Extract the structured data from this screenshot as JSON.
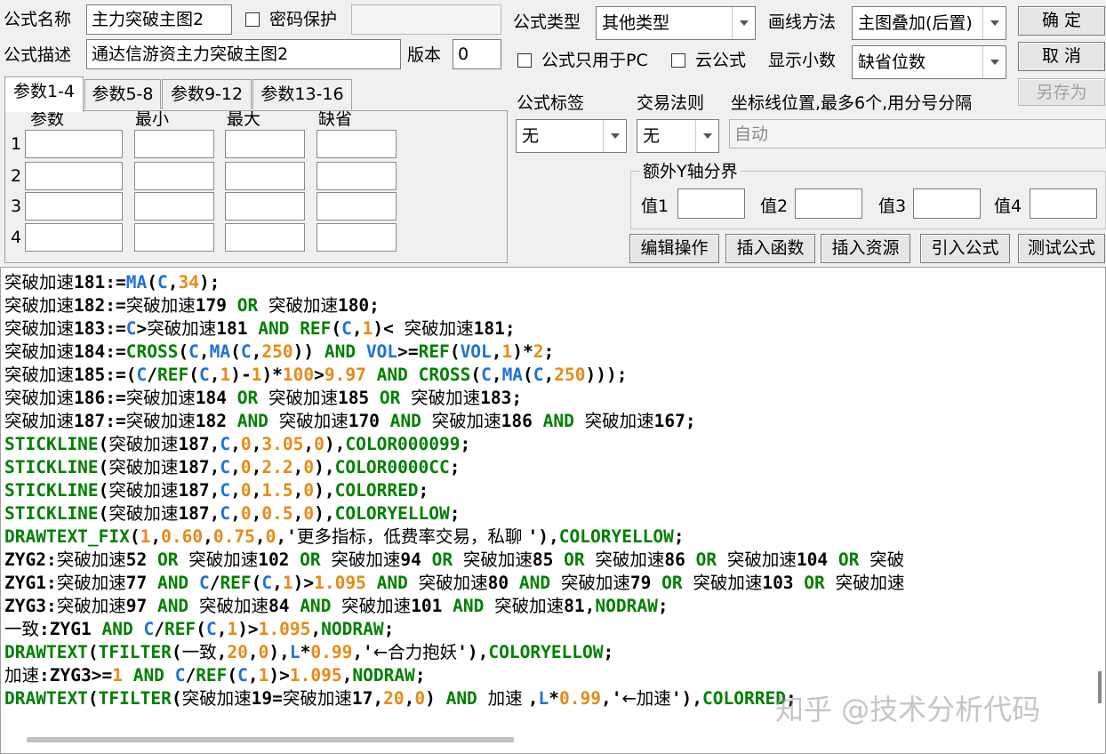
{
  "form": {
    "name_label": "公式名称",
    "name_value": "主力突破主图2",
    "password_label": "密码保护",
    "desc_label": "公式描述",
    "desc_value": "通达信游资主力突破主图2",
    "version_label": "版本",
    "version_value": "0",
    "type_label": "公式类型",
    "type_value": "其他类型",
    "draw_label": "画线方法",
    "draw_value": "主图叠加(后置)",
    "pc_only_label": "公式只用于PC",
    "cloud_label": "云公式",
    "decimals_label": "显示小数",
    "decimals_value": "缺省位数",
    "tag_label": "公式标签",
    "tag_value": "无",
    "rule_label": "交易法则",
    "rule_value": "无",
    "coord_label": "坐标线位置,最多6个,用分号分隔",
    "coord_value": "自动",
    "yaxis_label": "额外Y轴分界",
    "yaxis_values": [
      "值1",
      "值2",
      "值3",
      "值4"
    ]
  },
  "buttons": {
    "ok": "确 定",
    "cancel": "取 消",
    "save_as": "另存为",
    "edit": "编辑操作",
    "insert_func": "插入函数",
    "insert_res": "插入资源",
    "import": "引入公式",
    "test": "测试公式"
  },
  "params": {
    "tabs": [
      "参数1-4",
      "参数5-8",
      "参数9-12",
      "参数13-16"
    ],
    "headers": [
      "参数",
      "最小",
      "最大",
      "缺省"
    ],
    "rows": [
      "1",
      "2",
      "3",
      "4"
    ]
  },
  "code_lines": [
    [
      [
        "cn",
        "突破加速"
      ],
      [
        "k",
        "181:="
      ],
      [
        "b",
        "MA"
      ],
      [
        "k",
        "("
      ],
      [
        "b",
        "C"
      ],
      [
        "k",
        ","
      ],
      [
        "o",
        "34"
      ],
      [
        "k",
        ");"
      ]
    ],
    [
      [
        "cn",
        "突破加速"
      ],
      [
        "k",
        "182:="
      ],
      [
        "cn",
        "突破加速"
      ],
      [
        "k",
        "179 "
      ],
      [
        "g",
        "OR"
      ],
      [
        "k",
        " "
      ],
      [
        "cn",
        "突破加速"
      ],
      [
        "k",
        "180;"
      ]
    ],
    [
      [
        "cn",
        "突破加速"
      ],
      [
        "k",
        "183:="
      ],
      [
        "b",
        "C"
      ],
      [
        "k",
        ">"
      ],
      [
        "cn",
        "突破加速"
      ],
      [
        "k",
        "181 "
      ],
      [
        "g",
        "AND"
      ],
      [
        "k",
        " "
      ],
      [
        "g",
        "REF"
      ],
      [
        "k",
        "("
      ],
      [
        "b",
        "C"
      ],
      [
        "k",
        ","
      ],
      [
        "o",
        "1"
      ],
      [
        "k",
        ")< "
      ],
      [
        "cn",
        "突破加速"
      ],
      [
        "k",
        "181;"
      ]
    ],
    [
      [
        "cn",
        "突破加速"
      ],
      [
        "k",
        "184:="
      ],
      [
        "g",
        "CROSS"
      ],
      [
        "k",
        "("
      ],
      [
        "b",
        "C"
      ],
      [
        "k",
        ","
      ],
      [
        "b",
        "MA"
      ],
      [
        "k",
        "("
      ],
      [
        "b",
        "C"
      ],
      [
        "k",
        ","
      ],
      [
        "o",
        "250"
      ],
      [
        "k",
        ")) "
      ],
      [
        "g",
        "AND"
      ],
      [
        "k",
        " "
      ],
      [
        "b",
        "VOL"
      ],
      [
        "k",
        ">="
      ],
      [
        "g",
        "REF"
      ],
      [
        "k",
        "("
      ],
      [
        "b",
        "VOL"
      ],
      [
        "k",
        ","
      ],
      [
        "o",
        "1"
      ],
      [
        "k",
        ")*"
      ],
      [
        "o",
        "2"
      ],
      [
        "k",
        ";"
      ]
    ],
    [
      [
        "cn",
        "突破加速"
      ],
      [
        "k",
        "185:=("
      ],
      [
        "b",
        "C"
      ],
      [
        "k",
        "/"
      ],
      [
        "g",
        "REF"
      ],
      [
        "k",
        "("
      ],
      [
        "b",
        "C"
      ],
      [
        "k",
        ","
      ],
      [
        "o",
        "1"
      ],
      [
        "k",
        ")-"
      ],
      [
        "o",
        "1"
      ],
      [
        "k",
        ")*"
      ],
      [
        "o",
        "100"
      ],
      [
        "k",
        ">"
      ],
      [
        "o",
        "9.97"
      ],
      [
        "k",
        " "
      ],
      [
        "g",
        "AND"
      ],
      [
        "k",
        " "
      ],
      [
        "g",
        "CROSS"
      ],
      [
        "k",
        "("
      ],
      [
        "b",
        "C"
      ],
      [
        "k",
        ","
      ],
      [
        "b",
        "MA"
      ],
      [
        "k",
        "("
      ],
      [
        "b",
        "C"
      ],
      [
        "k",
        ","
      ],
      [
        "o",
        "250"
      ],
      [
        "k",
        ")));"
      ]
    ],
    [
      [
        "cn",
        "突破加速"
      ],
      [
        "k",
        "186:="
      ],
      [
        "cn",
        "突破加速"
      ],
      [
        "k",
        "184 "
      ],
      [
        "g",
        "OR"
      ],
      [
        "k",
        " "
      ],
      [
        "cn",
        "突破加速"
      ],
      [
        "k",
        "185 "
      ],
      [
        "g",
        "OR"
      ],
      [
        "k",
        " "
      ],
      [
        "cn",
        "突破加速"
      ],
      [
        "k",
        "183;"
      ]
    ],
    [
      [
        "cn",
        "突破加速"
      ],
      [
        "k",
        "187:="
      ],
      [
        "cn",
        "突破加速"
      ],
      [
        "k",
        "182 "
      ],
      [
        "g",
        "AND"
      ],
      [
        "k",
        " "
      ],
      [
        "cn",
        "突破加速"
      ],
      [
        "k",
        "170 "
      ],
      [
        "g",
        "AND"
      ],
      [
        "k",
        " "
      ],
      [
        "cn",
        "突破加速"
      ],
      [
        "k",
        "186 "
      ],
      [
        "g",
        "AND"
      ],
      [
        "k",
        " "
      ],
      [
        "cn",
        "突破加速"
      ],
      [
        "k",
        "167;"
      ]
    ],
    [
      [
        "g",
        "STICKLINE"
      ],
      [
        "k",
        "("
      ],
      [
        "cn",
        "突破加速"
      ],
      [
        "k",
        "187,"
      ],
      [
        "b",
        "C"
      ],
      [
        "k",
        ","
      ],
      [
        "o",
        "0"
      ],
      [
        "k",
        ","
      ],
      [
        "o",
        "3.05"
      ],
      [
        "k",
        ","
      ],
      [
        "o",
        "0"
      ],
      [
        "k",
        "),"
      ],
      [
        "g",
        "COLOR000099"
      ],
      [
        "k",
        ";"
      ]
    ],
    [
      [
        "g",
        "STICKLINE"
      ],
      [
        "k",
        "("
      ],
      [
        "cn",
        "突破加速"
      ],
      [
        "k",
        "187,"
      ],
      [
        "b",
        "C"
      ],
      [
        "k",
        ","
      ],
      [
        "o",
        "0"
      ],
      [
        "k",
        ","
      ],
      [
        "o",
        "2.2"
      ],
      [
        "k",
        ","
      ],
      [
        "o",
        "0"
      ],
      [
        "k",
        "),"
      ],
      [
        "g",
        "COLOR0000CC"
      ],
      [
        "k",
        ";"
      ]
    ],
    [
      [
        "g",
        "STICKLINE"
      ],
      [
        "k",
        "("
      ],
      [
        "cn",
        "突破加速"
      ],
      [
        "k",
        "187,"
      ],
      [
        "b",
        "C"
      ],
      [
        "k",
        ","
      ],
      [
        "o",
        "0"
      ],
      [
        "k",
        ","
      ],
      [
        "o",
        "1.5"
      ],
      [
        "k",
        ","
      ],
      [
        "o",
        "0"
      ],
      [
        "k",
        "),"
      ],
      [
        "g",
        "COLORRED"
      ],
      [
        "k",
        ";"
      ]
    ],
    [
      [
        "g",
        "STICKLINE"
      ],
      [
        "k",
        "("
      ],
      [
        "cn",
        "突破加速"
      ],
      [
        "k",
        "187,"
      ],
      [
        "b",
        "C"
      ],
      [
        "k",
        ","
      ],
      [
        "o",
        "0"
      ],
      [
        "k",
        ","
      ],
      [
        "o",
        "0.5"
      ],
      [
        "k",
        ","
      ],
      [
        "o",
        "0"
      ],
      [
        "k",
        "),"
      ],
      [
        "g",
        "COLORYELLOW"
      ],
      [
        "k",
        ";"
      ]
    ],
    [
      [
        "g",
        "DRAWTEXT_FIX"
      ],
      [
        "k",
        "("
      ],
      [
        "o",
        "1"
      ],
      [
        "k",
        ","
      ],
      [
        "o",
        "0.60"
      ],
      [
        "k",
        ","
      ],
      [
        "o",
        "0.75"
      ],
      [
        "k",
        ","
      ],
      [
        "o",
        "0"
      ],
      [
        "k",
        ",'"
      ],
      [
        "cn",
        "更多指标，低费率交易，私聊 "
      ],
      [
        "k",
        "'),"
      ],
      [
        "g",
        "COLORYELLOW"
      ],
      [
        "k",
        ";"
      ]
    ],
    [
      [
        "k",
        "ZYG2:"
      ],
      [
        "cn",
        "突破加速"
      ],
      [
        "k",
        "52 "
      ],
      [
        "g",
        "OR"
      ],
      [
        "k",
        " "
      ],
      [
        "cn",
        "突破加速"
      ],
      [
        "k",
        "102 "
      ],
      [
        "g",
        "OR"
      ],
      [
        "k",
        " "
      ],
      [
        "cn",
        "突破加速"
      ],
      [
        "k",
        "94 "
      ],
      [
        "g",
        "OR"
      ],
      [
        "k",
        " "
      ],
      [
        "cn",
        "突破加速"
      ],
      [
        "k",
        "85 "
      ],
      [
        "g",
        "OR"
      ],
      [
        "k",
        " "
      ],
      [
        "cn",
        "突破加速"
      ],
      [
        "k",
        "86 "
      ],
      [
        "g",
        "OR"
      ],
      [
        "k",
        " "
      ],
      [
        "cn",
        "突破加速"
      ],
      [
        "k",
        "104 "
      ],
      [
        "g",
        "OR"
      ],
      [
        "k",
        " "
      ],
      [
        "cn",
        "突破"
      ]
    ],
    [
      [
        "k",
        "ZYG1:"
      ],
      [
        "cn",
        "突破加速"
      ],
      [
        "k",
        "77 "
      ],
      [
        "g",
        "AND"
      ],
      [
        "k",
        " "
      ],
      [
        "b",
        "C"
      ],
      [
        "k",
        "/"
      ],
      [
        "g",
        "REF"
      ],
      [
        "k",
        "("
      ],
      [
        "b",
        "C"
      ],
      [
        "k",
        ","
      ],
      [
        "o",
        "1"
      ],
      [
        "k",
        ")>"
      ],
      [
        "o",
        "1.095"
      ],
      [
        "k",
        " "
      ],
      [
        "g",
        "AND"
      ],
      [
        "k",
        " "
      ],
      [
        "cn",
        "突破加速"
      ],
      [
        "k",
        "80 "
      ],
      [
        "g",
        "AND"
      ],
      [
        "k",
        " "
      ],
      [
        "cn",
        "突破加速"
      ],
      [
        "k",
        "79 "
      ],
      [
        "g",
        "OR"
      ],
      [
        "k",
        " "
      ],
      [
        "cn",
        "突破加速"
      ],
      [
        "k",
        "103 "
      ],
      [
        "g",
        "OR"
      ],
      [
        "k",
        " "
      ],
      [
        "cn",
        "突破加速"
      ]
    ],
    [
      [
        "k",
        "ZYG3:"
      ],
      [
        "cn",
        "突破加速"
      ],
      [
        "k",
        "97 "
      ],
      [
        "g",
        "AND"
      ],
      [
        "k",
        " "
      ],
      [
        "cn",
        "突破加速"
      ],
      [
        "k",
        "84 "
      ],
      [
        "g",
        "AND"
      ],
      [
        "k",
        " "
      ],
      [
        "cn",
        "突破加速"
      ],
      [
        "k",
        "101 "
      ],
      [
        "g",
        "AND"
      ],
      [
        "k",
        " "
      ],
      [
        "cn",
        "突破加速"
      ],
      [
        "k",
        "81,"
      ],
      [
        "g",
        "NODRAW"
      ],
      [
        "k",
        ";"
      ]
    ],
    [
      [
        "cn",
        "一致"
      ],
      [
        "k",
        ":ZYG1 "
      ],
      [
        "g",
        "AND"
      ],
      [
        "k",
        " "
      ],
      [
        "b",
        "C"
      ],
      [
        "k",
        "/"
      ],
      [
        "g",
        "REF"
      ],
      [
        "k",
        "("
      ],
      [
        "b",
        "C"
      ],
      [
        "k",
        ","
      ],
      [
        "o",
        "1"
      ],
      [
        "k",
        ")>"
      ],
      [
        "o",
        "1.095"
      ],
      [
        "k",
        ","
      ],
      [
        "g",
        "NODRAW"
      ],
      [
        "k",
        ";"
      ]
    ],
    [
      [
        "g",
        "DRAWTEXT"
      ],
      [
        "k",
        "("
      ],
      [
        "g",
        "TFILTER"
      ],
      [
        "k",
        "("
      ],
      [
        "cn",
        "一致"
      ],
      [
        "k",
        ","
      ],
      [
        "o",
        "20"
      ],
      [
        "k",
        ","
      ],
      [
        "o",
        "0"
      ],
      [
        "k",
        "),"
      ],
      [
        "b",
        "L"
      ],
      [
        "k",
        "*"
      ],
      [
        "o",
        "0.99"
      ],
      [
        "k",
        ",'"
      ],
      [
        "cn",
        "←合力抱妖"
      ],
      [
        "k",
        "'),"
      ],
      [
        "g",
        "COLORYELLOW"
      ],
      [
        "k",
        ";"
      ]
    ],
    [
      [
        "cn",
        "加速"
      ],
      [
        "k",
        ":ZYG3>="
      ],
      [
        "o",
        "1"
      ],
      [
        "k",
        " "
      ],
      [
        "g",
        "AND"
      ],
      [
        "k",
        " "
      ],
      [
        "b",
        "C"
      ],
      [
        "k",
        "/"
      ],
      [
        "g",
        "REF"
      ],
      [
        "k",
        "("
      ],
      [
        "b",
        "C"
      ],
      [
        "k",
        ","
      ],
      [
        "o",
        "1"
      ],
      [
        "k",
        ")>"
      ],
      [
        "o",
        "1.095"
      ],
      [
        "k",
        ","
      ],
      [
        "g",
        "NODRAW"
      ],
      [
        "k",
        ";"
      ]
    ],
    [
      [
        "g",
        "DRAWTEXT"
      ],
      [
        "k",
        "("
      ],
      [
        "g",
        "TFILTER"
      ],
      [
        "k",
        "("
      ],
      [
        "cn",
        "突破加速"
      ],
      [
        "k",
        "19="
      ],
      [
        "cn",
        "突破加速"
      ],
      [
        "k",
        "17,"
      ],
      [
        "o",
        "20"
      ],
      [
        "k",
        ","
      ],
      [
        "o",
        "0"
      ],
      [
        "k",
        ") "
      ],
      [
        "g",
        "AND"
      ],
      [
        "k",
        " "
      ],
      [
        "cn",
        "加速 "
      ],
      [
        "k",
        ","
      ],
      [
        "b",
        "L"
      ],
      [
        "k",
        "*"
      ],
      [
        "o",
        "0.99"
      ],
      [
        "k",
        ",'"
      ],
      [
        "cn",
        "←加速"
      ],
      [
        "k",
        "'),"
      ],
      [
        "g",
        "COLORRED"
      ],
      [
        "k",
        ";"
      ]
    ]
  ],
  "watermark": "知乎 @技术分析代码",
  "colors": {
    "keyword": "#008000",
    "variable": "#1e73d8",
    "number": "#e88a14"
  }
}
